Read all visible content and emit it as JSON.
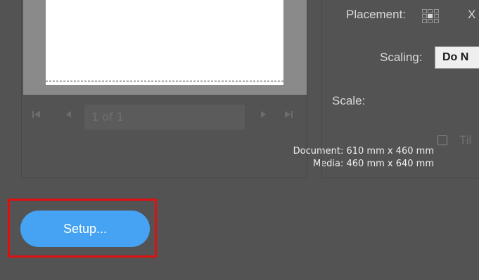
{
  "preview": {
    "pager": {
      "first_icon": "skip-first-icon",
      "prev_icon": "prev-icon",
      "next_icon": "next-icon",
      "last_icon": "skip-last-icon",
      "page_value": "1 of 1"
    },
    "document_size": "Document: 610 mm x 460 mm",
    "media_size": "Media: 460 mm x 640 mm"
  },
  "options": {
    "placement_label": "Placement:",
    "x_label": "X",
    "scaling_label": "Scaling:",
    "scaling_value": "Do N",
    "scale_label": "Scale:",
    "tile_label": "Til",
    "tile_checked": false
  },
  "buttons": {
    "setup_label": "Setup..."
  },
  "colors": {
    "background": "#535353",
    "setup_button": "#46a3f3",
    "highlight_border": "#e01010"
  }
}
